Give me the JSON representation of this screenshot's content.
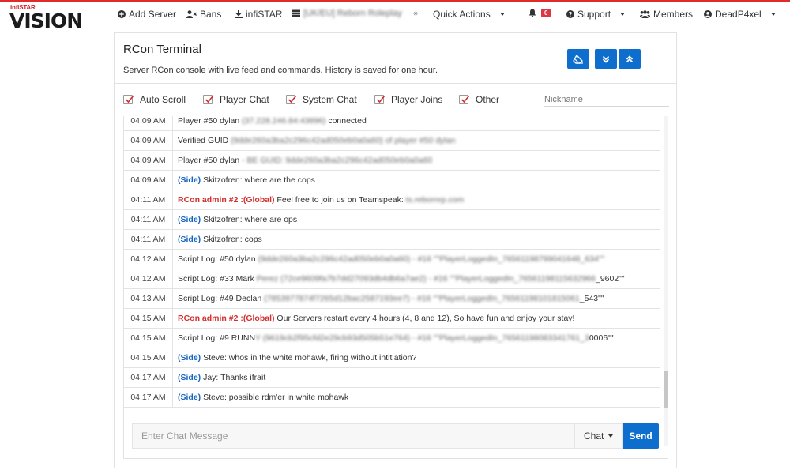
{
  "brand": {
    "top": "infiSTAR",
    "main": "VISION"
  },
  "nav": {
    "add_server": "Add Server",
    "bans": "Bans",
    "infistar": "infiSTAR",
    "server": "[UK/EU] Reborn Roleplay",
    "quick_actions": "Quick Actions",
    "notif_count": "0",
    "support": "Support",
    "members": "Members",
    "user": "DeadP4xel"
  },
  "terminal": {
    "title": "RCon Terminal",
    "subtitle": "Server RCon console with live feed and commands. History is saved for one hour."
  },
  "filters": [
    {
      "label": "Auto Scroll",
      "checked": true
    },
    {
      "label": "Player Chat",
      "checked": true
    },
    {
      "label": "System Chat",
      "checked": true
    },
    {
      "label": "Player Joins",
      "checked": true
    },
    {
      "label": "Other",
      "checked": true
    }
  ],
  "nickname_placeholder": "Nickname",
  "log": [
    {
      "time": "04:09 AM",
      "prefix": "",
      "type": "plain",
      "text": "Player #50 dylan ",
      "blur": "(37.228.246.84:43896)",
      "tail": " connected"
    },
    {
      "time": "04:09 AM",
      "prefix": "",
      "type": "plain",
      "text": "Verified GUID ",
      "blur": "(9dde260a3ba2c296c42ad050eb0a0a60) of player #50 dylan",
      "tail": ""
    },
    {
      "time": "04:09 AM",
      "prefix": "",
      "type": "plain",
      "text": "Player #50 dylan",
      "blur": " - BE GUID: 9dde260a3ba2c296c42ad050eb0a0a60",
      "tail": ""
    },
    {
      "time": "04:09 AM",
      "prefix": "(Side)",
      "type": "side",
      "text": " Skitzofren: where are the cops",
      "blur": "",
      "tail": ""
    },
    {
      "time": "04:11 AM",
      "prefix": "RCon admin #2 :(Global)",
      "type": "admin",
      "text": " Feel free to join us on Teamspeak: ",
      "blur": "ts.rebornrp.com",
      "tail": ""
    },
    {
      "time": "04:11 AM",
      "prefix": "(Side)",
      "type": "side",
      "text": " Skitzofren: where are ops",
      "blur": "",
      "tail": ""
    },
    {
      "time": "04:11 AM",
      "prefix": "(Side)",
      "type": "side",
      "text": " Skitzofren: cops",
      "blur": "",
      "tail": ""
    },
    {
      "time": "04:12 AM",
      "prefix": "",
      "type": "plain",
      "text": "Script Log: #50 dylan ",
      "blur": "(9dde260a3ba2c296c42ad050eb0a0a60) - #16 \"\"PlayerLoggedIn_76561198799041648_634\"\"",
      "tail": ""
    },
    {
      "time": "04:12 AM",
      "prefix": "",
      "type": "plain",
      "text": "Script Log: #33 Mark ",
      "blur": "Perez (72ce9609fa7b7dd27093db4db6a7ae2) - #16 \"\"PlayerLoggedIn_76561198115632966",
      "tail": "_9602\"\""
    },
    {
      "time": "04:13 AM",
      "prefix": "",
      "type": "plain",
      "text": "Script Log: #49 Declan ",
      "blur": "(7853977874f7265d12bac2587193ee7) - #16 \"\"PlayerLoggedIn_76561198101815061",
      "tail": "_543\"\""
    },
    {
      "time": "04:15 AM",
      "prefix": "RCon admin #2 :(Global)",
      "type": "admin",
      "text": " Our Servers restart every 4 hours (4, 8 and 12), So have fun and enjoy your stay!",
      "blur": "",
      "tail": ""
    },
    {
      "time": "04:15 AM",
      "prefix": "",
      "type": "plain",
      "text": "Script Log: #9 RUNN",
      "blur": "Y (9619cb2f95cfd2e29cb93d505b51e764) - #16 \"\"PlayerLoggedIn_76561198083341761_3",
      "tail": "0006\"\""
    },
    {
      "time": "04:15 AM",
      "prefix": "(Side)",
      "type": "side",
      "text": " Steve: whos in the white mohawk, firing without intitiation?",
      "blur": "",
      "tail": ""
    },
    {
      "time": "04:17 AM",
      "prefix": "(Side)",
      "type": "side",
      "text": " Jay: Thanks ifrait",
      "blur": "",
      "tail": ""
    },
    {
      "time": "04:17 AM",
      "prefix": "(Side)",
      "type": "side",
      "text": " Steve: possible rdm'er in white mohawk",
      "blur": "",
      "tail": ""
    }
  ],
  "chat": {
    "placeholder": "Enter Chat Message",
    "type": "Chat",
    "send": "Send"
  },
  "colors": {
    "accent": "#0d6ecd",
    "side": "#1565c0",
    "admin": "#d32f2f",
    "badge": "#dc3545"
  }
}
